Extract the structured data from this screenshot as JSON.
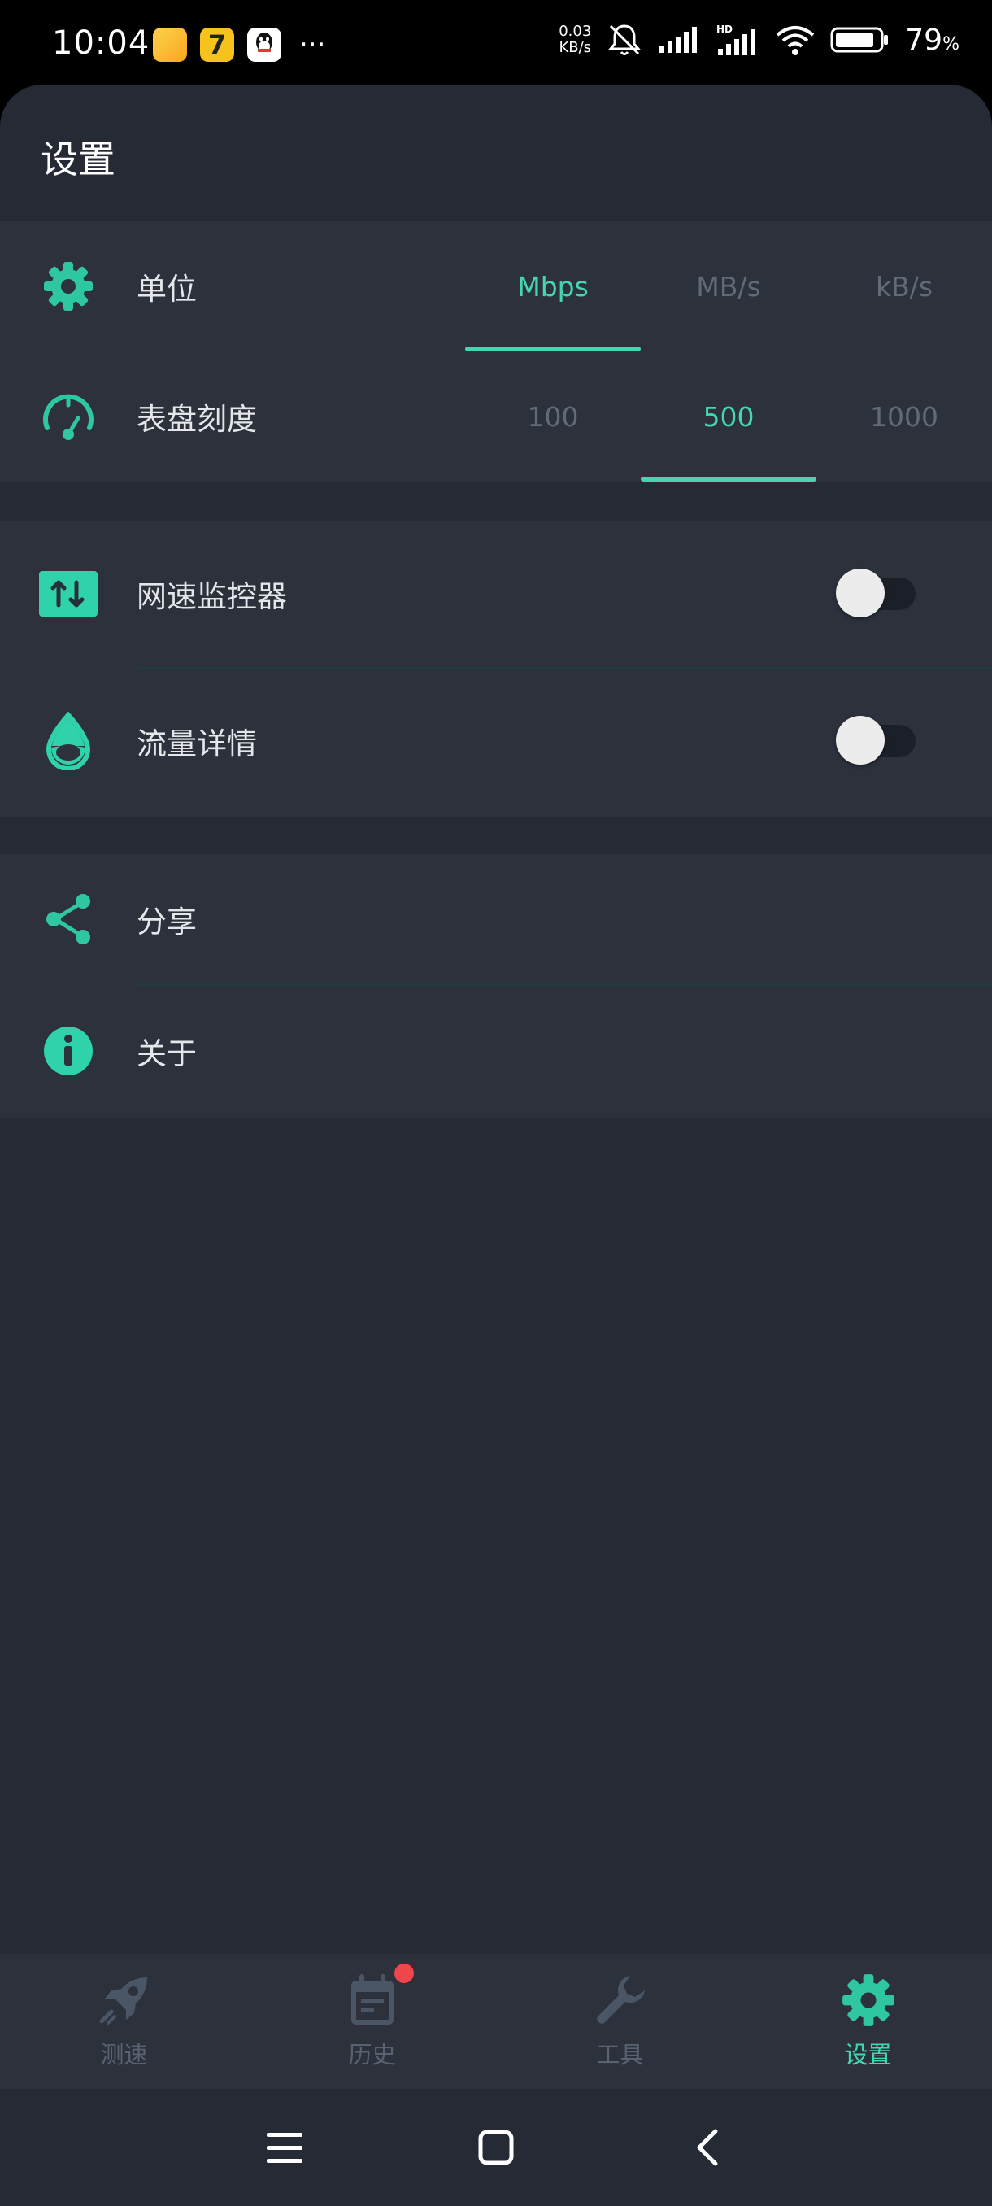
{
  "status_bar": {
    "time": "10:04",
    "net_speed_value": "0.03",
    "net_speed_unit": "KB/s",
    "battery_percent": "79",
    "battery_unit": "%",
    "more": "···"
  },
  "page": {
    "title": "设置"
  },
  "settings": {
    "unit": {
      "label": "单位",
      "options": [
        "Mbps",
        "MB/s",
        "kB/s"
      ],
      "selected": "Mbps"
    },
    "dial": {
      "label": "表盘刻度",
      "options": [
        "100",
        "500",
        "1000"
      ],
      "selected": "500"
    },
    "monitor": {
      "label": "网速监控器",
      "enabled": false
    },
    "traffic": {
      "label": "流量详情",
      "enabled": false
    },
    "share": {
      "label": "分享"
    },
    "about": {
      "label": "关于"
    }
  },
  "bottom_nav": {
    "items": [
      {
        "label": "测速",
        "icon": "rocket-icon"
      },
      {
        "label": "历史",
        "icon": "calendar-icon"
      },
      {
        "label": "工具",
        "icon": "wrench-icon"
      },
      {
        "label": "设置",
        "icon": "gear-icon"
      }
    ],
    "active": "设置"
  },
  "colors": {
    "accent": "#45d6b0",
    "background": "#252a35",
    "card": "#2c313c",
    "inactive": "#586273",
    "badge": "#f0464b"
  }
}
